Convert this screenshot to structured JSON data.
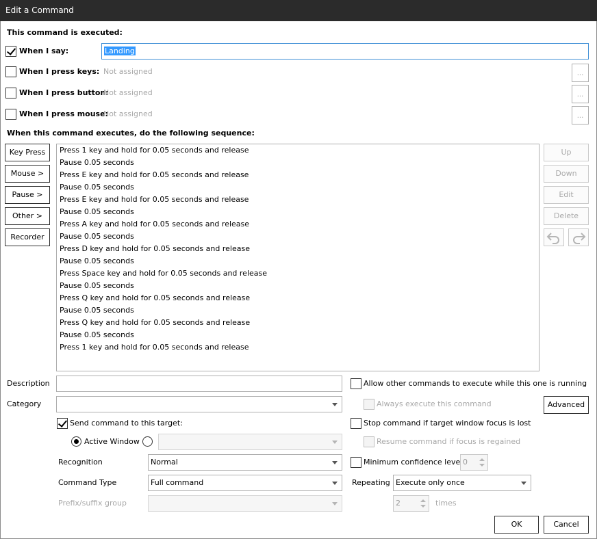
{
  "window": {
    "title": "Edit a Command"
  },
  "triggers": {
    "heading": "This command is executed:",
    "when_i_say": {
      "label": "When I say:",
      "checked": true,
      "value": "Landing"
    },
    "when_i_press_keys": {
      "label": "When I press keys:",
      "checked": false,
      "value": "Not assigned",
      "button": "..."
    },
    "when_i_press_button": {
      "label": "When I press button:",
      "checked": false,
      "value": "Not assigned",
      "button": "..."
    },
    "when_i_press_mouse": {
      "label": "When I press mouse:",
      "checked": false,
      "value": "Not assigned",
      "button": "..."
    }
  },
  "sequence": {
    "heading": "When this command executes, do the following sequence:",
    "left_buttons": [
      "Key Press",
      "Mouse >",
      "Pause >",
      "Other >",
      "Recorder"
    ],
    "right_buttons": [
      "Up",
      "Down",
      "Edit",
      "Delete"
    ],
    "actions": [
      "Press 1 key and hold for 0.05 seconds and release",
      "Pause 0.05 seconds",
      "Press E key and hold for 0.05 seconds and release",
      "Pause 0.05 seconds",
      "Press E key and hold for 0.05 seconds and release",
      "Pause 0.05 seconds",
      "Press A key and hold for 0.05 seconds and release",
      "Pause 0.05 seconds",
      "Press D key and hold for 0.05 seconds and release",
      "Pause 0.05 seconds",
      "Press Space key and hold for 0.05 seconds and release",
      "Pause 0.05 seconds",
      "Press Q key and hold for 0.05 seconds and release",
      "Pause 0.05 seconds",
      "Press Q key and hold for 0.05 seconds and release",
      "Pause 0.05 seconds",
      "Press 1 key and hold for 0.05 seconds and release"
    ]
  },
  "fields": {
    "description_label": "Description",
    "description_value": "",
    "category_label": "Category",
    "category_value": "",
    "send_command_label": "Send command to this target:",
    "send_command_checked": true,
    "active_window_label": "Active Window",
    "target_value": "",
    "recognition_label": "Recognition",
    "recognition_value": "Normal",
    "command_type_label": "Command Type",
    "command_type_value": "Full command",
    "prefix_suffix_label": "Prefix/suffix group",
    "prefix_suffix_value": ""
  },
  "options": {
    "allow_other": "Allow other commands to execute while this one is running",
    "always_execute": "Always execute this command",
    "advanced_button": "Advanced",
    "stop_command": "Stop command if target window focus is lost",
    "resume_command": "Resume command if focus is regained",
    "min_confidence_label": "Minimum confidence level",
    "min_confidence_value": "0",
    "repeating_label": "Repeating",
    "repeating_value": "Execute only once",
    "repeat_times_value": "2",
    "times_label": "times"
  },
  "footer": {
    "ok": "OK",
    "cancel": "Cancel"
  }
}
